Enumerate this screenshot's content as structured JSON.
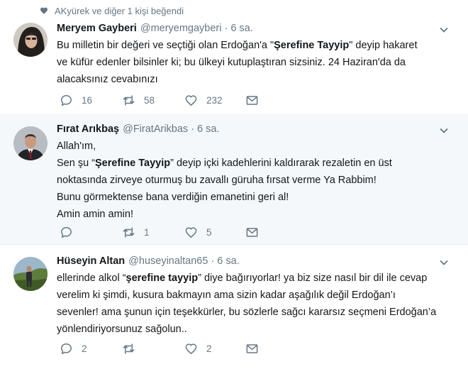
{
  "liked_note": "AKyürek ve diğer 1 kişi beğendi",
  "tweets": [
    {
      "name": "Meryem Gayberi",
      "handle": "@meryemgayberi",
      "time": "6 sa.",
      "lines": [
        [
          "Bu milletin bir değeri ve seçtiği olan Erdoğan'a \"",
          "Şerefine Tayyip",
          "\" deyip hakaret"
        ],
        [
          "ve küfür edenler bilsinler ki; bu ülkeyi kutuplaştıran sizsiniz. 24 Haziran'da da"
        ],
        [
          "alacaksınız cevabınızı"
        ]
      ],
      "replies": "16",
      "retweets": "58",
      "likes": "232"
    },
    {
      "name": "Fırat Arıkbaş",
      "handle": "@FiratArikbas",
      "time": "6 sa.",
      "lines": [
        [
          "Allah'ım,"
        ],
        [
          "Sen şu “",
          "Şerefine Tayyip",
          "” deyip içki kadehlerini kaldırarak rezaletin en üst"
        ],
        [
          "noktasında zirveye oturmuş bu zavallı güruha fırsat verme Ya Rabbim!"
        ],
        [
          "Bunu görmektense bana verdiğin emanetini geri al!"
        ],
        [
          "Amin amin amin!"
        ]
      ],
      "replies": "",
      "retweets": "1",
      "likes": "5"
    },
    {
      "name": "Hüseyin Altan",
      "handle": "@huseyinaltan65",
      "time": "6 sa.",
      "lines": [
        [
          "ellerinde alkol “",
          "şerefine tayyip",
          "” diye bağırıyorlar! ya  biz size nasıl bir dil ile cevap"
        ],
        [
          "verelim ki şimdi, kusura bakmayın ama sizin kadar aşağılık değil Erdoğan’ı"
        ],
        [
          "sevenler! ama şunun için teşekkürler, bu sözlerle sağcı kararsız seçmeni Erdoğan’a"
        ],
        [
          "yönlendiriyorsunuz sağolun.."
        ]
      ],
      "replies": "2",
      "retweets": "",
      "likes": "2"
    }
  ]
}
